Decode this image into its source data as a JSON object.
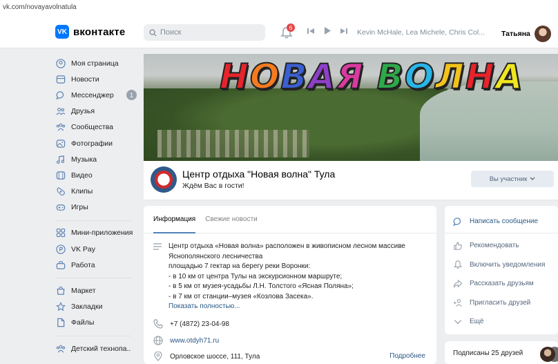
{
  "browser": {
    "url": "vk.com/novayavolnatula"
  },
  "header": {
    "logo_mark": "VK",
    "logo_text": "вконтакте",
    "search_placeholder": "Поиск",
    "notifications_count": "6",
    "now_playing": "Kevin McHale, Lea Michele, Chris Col...",
    "user_name": "Татьяна"
  },
  "sidebar": {
    "items": [
      {
        "label": "Моя страница",
        "icon": "user-circle-icon"
      },
      {
        "label": "Новости",
        "icon": "news-icon"
      },
      {
        "label": "Мессенджер",
        "icon": "message-icon",
        "badge": "1"
      },
      {
        "label": "Друзья",
        "icon": "friends-icon"
      },
      {
        "label": "Сообщества",
        "icon": "communities-icon"
      },
      {
        "label": "Фотографии",
        "icon": "photo-icon"
      },
      {
        "label": "Музыка",
        "icon": "music-icon"
      },
      {
        "label": "Видео",
        "icon": "video-icon"
      },
      {
        "label": "Клипы",
        "icon": "clips-icon"
      },
      {
        "label": "Игры",
        "icon": "games-icon"
      }
    ],
    "items2": [
      {
        "label": "Мини-приложения",
        "icon": "apps-icon"
      },
      {
        "label": "VK Pay",
        "icon": "vkpay-icon"
      },
      {
        "label": "Работа",
        "icon": "work-icon"
      }
    ],
    "items3": [
      {
        "label": "Маркет",
        "icon": "market-icon"
      },
      {
        "label": "Закладки",
        "icon": "bookmark-icon"
      },
      {
        "label": "Файлы",
        "icon": "file-icon"
      }
    ],
    "items4": [
      {
        "label": "Детский технопа..",
        "icon": "community-icon"
      }
    ]
  },
  "cover": {
    "title_letters": [
      "Н",
      "О",
      "В",
      "А",
      "Я",
      " ",
      "В",
      "О",
      "Л",
      "Н",
      "А"
    ],
    "letter_colors": [
      "#e8232b",
      "#f47b20",
      "#3a5fd0",
      "#8e3fc8",
      "#d93aa0",
      "#ffffff",
      "#2fa84a",
      "#29b5e8",
      "#f4c21b",
      "#e8232b",
      "#f1e61d"
    ]
  },
  "profile": {
    "name": "Центр отдыха \"Новая волна\" Тула",
    "status": "Ждём Вас в гости!",
    "member_button": "Вы участник"
  },
  "info": {
    "tabs": [
      "Информация",
      "Свежие новости"
    ],
    "description": [
      "Центр отдыха «Новая волна» расположен в живописном лесном массиве",
      "Яснополянского лесничества",
      "площадью 7 гектар на берегу реки Воронки:",
      "- в 10 км от центра Тулы на экскурсионном маршруте;",
      "- в 5 км от музея-усадьбы Л.Н. Толстого «Ясная Поляна»;",
      "- в 7 км от станции–музея «Козлова Засека»."
    ],
    "show_more": "Показать полностью...",
    "phone": "+7 (4872) 23-04-98",
    "website": "www.otdyh71.ru",
    "address": "Орловское шоссе, 111, Тула",
    "details_link": "Подробнее"
  },
  "actions": {
    "items": [
      {
        "label": "Написать сообщение",
        "icon": "message-icon"
      },
      {
        "label": "Рекомендовать",
        "icon": "thumbs-up-icon"
      },
      {
        "label": "Включить уведомления",
        "icon": "bell-icon"
      },
      {
        "label": "Рассказать друзьям",
        "icon": "share-icon"
      },
      {
        "label": "Пригласить друзей",
        "icon": "invite-icon"
      },
      {
        "label": "Ещё",
        "icon": "chevron-down-icon"
      }
    ]
  },
  "friends": {
    "label": "Подписаны 25 друзей"
  }
}
